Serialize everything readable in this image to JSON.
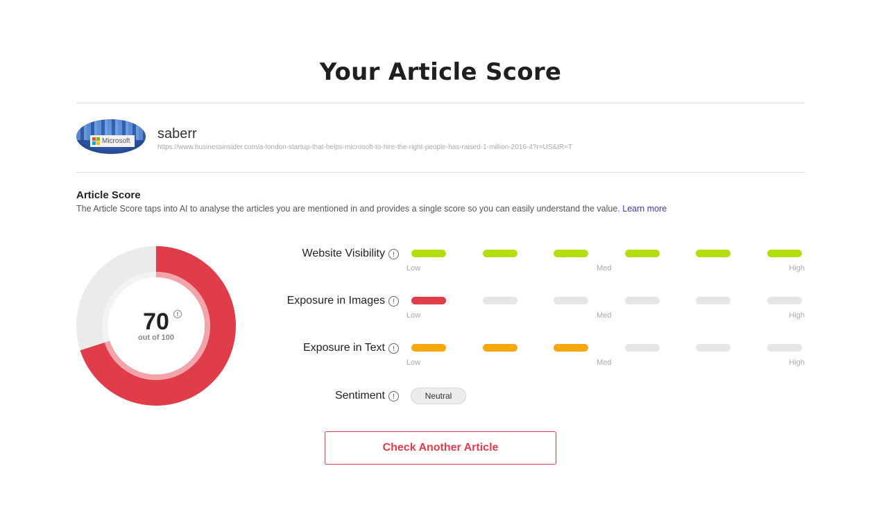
{
  "page": {
    "title": "Your Article Score"
  },
  "source": {
    "name": "saberr",
    "url": "https://www.businessinsider.com/a-london-startup-that-helps-microsoft-to-hire-the-right-people-has-raised-1-million-2016-4?r=US&IR=T",
    "image_text": "Microsoft"
  },
  "section": {
    "title": "Article Score",
    "description": "The Article Score taps into AI to analyse the articles you are mentioned in and provides a single score so you can easily understand the value.",
    "learn_more": "Learn more"
  },
  "score": {
    "value": "70",
    "max": 100,
    "subtitle": "out of 100",
    "colors": {
      "fill": "#e03c4a",
      "inner_ring": "#f1a4a9",
      "track": "#ebebeb"
    }
  },
  "scale_labels": {
    "low": "Low",
    "med": "Med",
    "high": "High"
  },
  "metrics": [
    {
      "label": "Website Visibility",
      "level": 6,
      "total": 6,
      "color": "#b3df10"
    },
    {
      "label": "Exposure in Images",
      "level": 1,
      "total": 6,
      "color": "#e03c4a"
    },
    {
      "label": "Exposure in Text",
      "level": 3,
      "total": 6,
      "color": "#f7a80c"
    }
  ],
  "inactive_bar_color": "#e6e6e6",
  "sentiment": {
    "label": "Sentiment",
    "value": "Neutral"
  },
  "cta": {
    "label": "Check Another Article"
  },
  "icons": {
    "info": "info-icon"
  }
}
